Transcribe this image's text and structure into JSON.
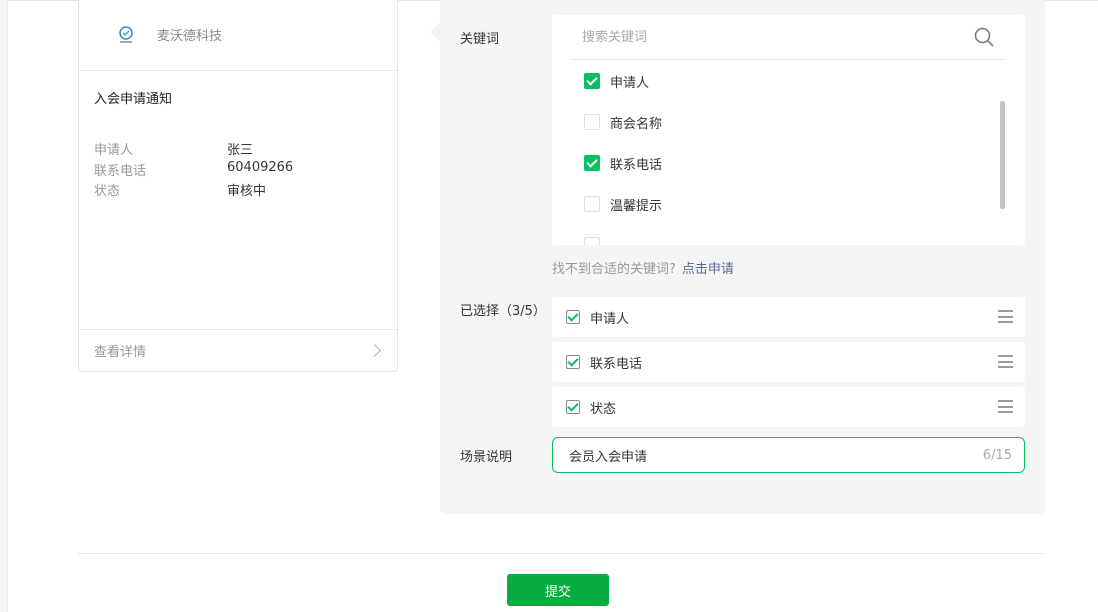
{
  "preview": {
    "brand_name": "麦沃德科技",
    "title": "入会申请通知",
    "fields": [
      {
        "label": "申请人",
        "value": "张三"
      },
      {
        "label": "联系电话",
        "value": "60409266"
      },
      {
        "label": "状态",
        "value": "审核中"
      }
    ],
    "footer_link": "查看详情"
  },
  "keywords": {
    "label": "关键词",
    "search_placeholder": "搜索关键词",
    "options": [
      {
        "label": "申请人",
        "checked": true
      },
      {
        "label": "商会名称",
        "checked": false
      },
      {
        "label": "联系电话",
        "checked": true
      },
      {
        "label": "温馨提示",
        "checked": false
      }
    ],
    "hint_text": "找不到合适的关键词?",
    "hint_link": "点击申请"
  },
  "selected": {
    "label": "已选择（3/5）",
    "items": [
      "申请人",
      "联系电话",
      "状态"
    ]
  },
  "scene": {
    "label": "场景说明",
    "value": "会员入会申请",
    "counter": "6/15"
  },
  "submit_label": "提交",
  "colors": {
    "accent": "#07c160",
    "button": "#07ad3e",
    "link": "#576b95"
  }
}
